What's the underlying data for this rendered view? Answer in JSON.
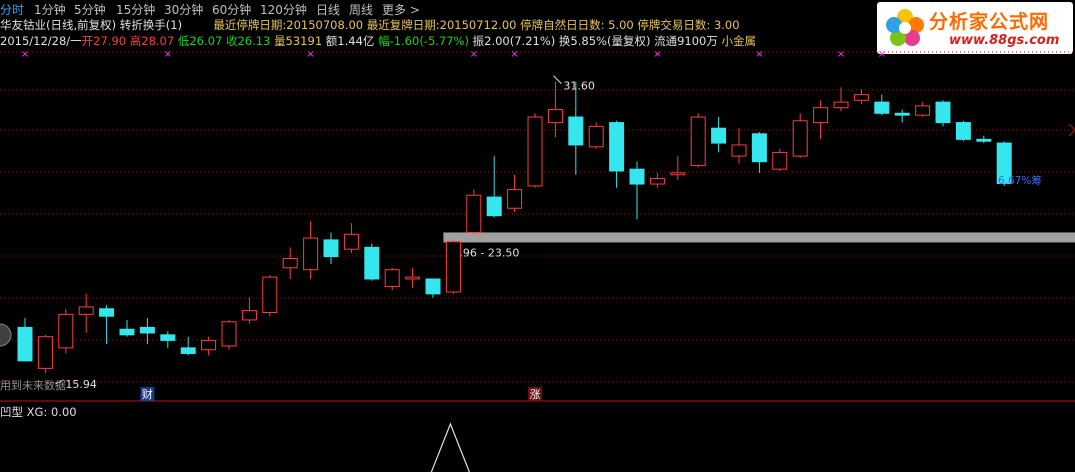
{
  "toolbar": {
    "items": [
      "分时",
      "1分钟",
      "5分钟",
      "15分钟",
      "30分钟",
      "60分钟",
      "120分钟",
      "日线",
      "周线",
      "更多 >"
    ],
    "active_index": 0
  },
  "header": {
    "stock_title": "华友钴业(日线,前复权) 转折换手(1)",
    "last_suspend_label": "最近停牌日期:",
    "last_suspend_value": "20150708.00",
    "last_resume_label": "最近复牌日期:",
    "last_resume_value": "20150712.00",
    "suspend_natural_days_label": "停牌自然日日数:",
    "suspend_natural_days_value": "5.00",
    "suspend_trade_days_label": "停牌交易日数:",
    "suspend_trade_days_value": "3.00"
  },
  "quote": {
    "date": "2015/12/28/一",
    "open_label": "开",
    "open": "27.90",
    "high_label": "高",
    "high": "28.07",
    "low_label": "低",
    "low": "26.07",
    "close_label": "收",
    "close": "26.13",
    "volume_label": "量",
    "volume": "53191",
    "amount_label": "额",
    "amount": "1.44亿",
    "change_label": "幅",
    "change": "-1.60(-5.77%)",
    "amplitude_label": "振",
    "amplitude": "2.00(7.21%)",
    "turnover_label": "换",
    "turnover": "5.85%(量复权)",
    "float_label": "流通",
    "float_shares": "9100万",
    "sector": "小金属"
  },
  "logo": {
    "title": "分析家公式网",
    "url": "www.88gs.com"
  },
  "sub_panel": {
    "name": "凹型",
    "xg_label": "XG:",
    "xg_value": "0.00"
  },
  "future_hint": "用到未来数据",
  "colors": {
    "up": "#ff3c3c",
    "down": "#35e6ee",
    "grid": "#8a1515",
    "band": "#a0a0a0",
    "signal": "#ff33ff"
  },
  "chart_data": {
    "type": "candlestick",
    "ylim": [
      14.5,
      33.3
    ],
    "high_label": "31.60",
    "low_label": "15.94",
    "band": {
      "low": 22.96,
      "high": 23.5,
      "label": "22.96 - 23.50"
    },
    "percent_label": "6.67%筹",
    "badges": [
      "财",
      "涨"
    ],
    "signal_marks": "×",
    "candles": [
      {
        "o": 18.4,
        "h": 18.9,
        "l": 16.6,
        "c": 16.6
      },
      {
        "o": 16.2,
        "h": 18.0,
        "l": 15.94,
        "c": 17.9
      },
      {
        "o": 17.3,
        "h": 19.4,
        "l": 17.0,
        "c": 19.1
      },
      {
        "o": 19.1,
        "h": 20.2,
        "l": 18.1,
        "c": 19.5
      },
      {
        "o": 19.4,
        "h": 19.6,
        "l": 17.5,
        "c": 19.0
      },
      {
        "o": 18.3,
        "h": 18.8,
        "l": 17.9,
        "c": 18.0
      },
      {
        "o": 18.4,
        "h": 18.9,
        "l": 17.5,
        "c": 18.1
      },
      {
        "o": 18.0,
        "h": 18.2,
        "l": 17.3,
        "c": 17.7
      },
      {
        "o": 17.3,
        "h": 17.9,
        "l": 16.9,
        "c": 17.0
      },
      {
        "o": 17.2,
        "h": 17.9,
        "l": 16.9,
        "c": 17.7
      },
      {
        "o": 17.4,
        "h": 18.8,
        "l": 17.2,
        "c": 18.7
      },
      {
        "o": 18.8,
        "h": 20.0,
        "l": 18.6,
        "c": 19.3
      },
      {
        "o": 19.2,
        "h": 21.2,
        "l": 19.0,
        "c": 21.1
      },
      {
        "o": 21.6,
        "h": 22.7,
        "l": 21.0,
        "c": 22.1
      },
      {
        "o": 21.5,
        "h": 24.1,
        "l": 21.0,
        "c": 23.2
      },
      {
        "o": 23.1,
        "h": 23.5,
        "l": 21.8,
        "c": 22.2
      },
      {
        "o": 22.6,
        "h": 24.0,
        "l": 22.4,
        "c": 23.4
      },
      {
        "o": 22.7,
        "h": 22.9,
        "l": 20.9,
        "c": 21.0
      },
      {
        "o": 20.6,
        "h": 21.6,
        "l": 20.4,
        "c": 21.5
      },
      {
        "o": 21.0,
        "h": 21.6,
        "l": 20.5,
        "c": 21.1
      },
      {
        "o": 21.0,
        "h": 21.0,
        "l": 20.0,
        "c": 20.2
      },
      {
        "o": 20.3,
        "h": 23.1,
        "l": 20.2,
        "c": 23.0
      },
      {
        "o": 23.5,
        "h": 25.8,
        "l": 23.4,
        "c": 25.5
      },
      {
        "o": 25.4,
        "h": 27.6,
        "l": 24.3,
        "c": 24.4
      },
      {
        "o": 24.8,
        "h": 26.6,
        "l": 24.6,
        "c": 25.8
      },
      {
        "o": 26.0,
        "h": 29.9,
        "l": 25.9,
        "c": 29.7
      },
      {
        "o": 29.4,
        "h": 31.6,
        "l": 28.6,
        "c": 30.1
      },
      {
        "o": 29.7,
        "h": 31.6,
        "l": 26.6,
        "c": 28.2
      },
      {
        "o": 28.1,
        "h": 29.4,
        "l": 28.0,
        "c": 29.2
      },
      {
        "o": 29.4,
        "h": 29.5,
        "l": 25.9,
        "c": 26.8
      },
      {
        "o": 26.9,
        "h": 27.3,
        "l": 24.2,
        "c": 26.1
      },
      {
        "o": 26.1,
        "h": 26.7,
        "l": 25.9,
        "c": 26.4
      },
      {
        "o": 26.6,
        "h": 27.6,
        "l": 26.3,
        "c": 26.7
      },
      {
        "o": 27.1,
        "h": 29.9,
        "l": 27.0,
        "c": 29.7
      },
      {
        "o": 29.1,
        "h": 29.7,
        "l": 27.8,
        "c": 28.3
      },
      {
        "o": 27.6,
        "h": 29.1,
        "l": 27.2,
        "c": 28.2
      },
      {
        "o": 28.8,
        "h": 28.9,
        "l": 26.7,
        "c": 27.3
      },
      {
        "o": 26.9,
        "h": 28.0,
        "l": 26.8,
        "c": 27.8
      },
      {
        "o": 27.6,
        "h": 29.9,
        "l": 27.5,
        "c": 29.5
      },
      {
        "o": 29.4,
        "h": 30.6,
        "l": 28.5,
        "c": 30.2
      },
      {
        "o": 30.2,
        "h": 31.3,
        "l": 30.0,
        "c": 30.5
      },
      {
        "o": 30.6,
        "h": 31.2,
        "l": 30.4,
        "c": 30.9
      },
      {
        "o": 30.5,
        "h": 30.9,
        "l": 29.8,
        "c": 29.9
      },
      {
        "o": 29.9,
        "h": 30.1,
        "l": 29.4,
        "c": 29.8
      },
      {
        "o": 29.8,
        "h": 30.5,
        "l": 29.7,
        "c": 30.3
      },
      {
        "o": 30.5,
        "h": 30.6,
        "l": 29.2,
        "c": 29.4
      },
      {
        "o": 29.4,
        "h": 29.5,
        "l": 28.4,
        "c": 28.5
      },
      {
        "o": 28.5,
        "h": 28.7,
        "l": 28.3,
        "c": 28.4
      },
      {
        "o": 28.3,
        "h": 28.4,
        "l": 26.0,
        "c": 26.13
      }
    ],
    "sub_signal": {
      "x_index": 21,
      "value": 0.0
    }
  }
}
